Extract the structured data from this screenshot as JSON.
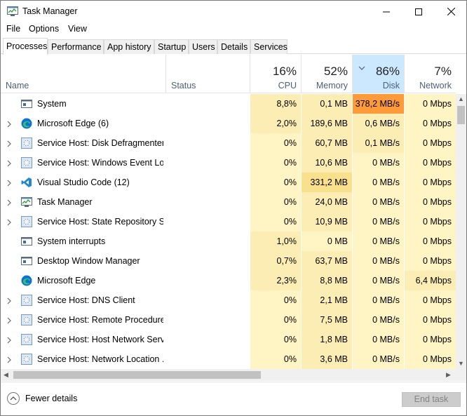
{
  "window": {
    "title": "Task Manager"
  },
  "menu": [
    "File",
    "Options",
    "View"
  ],
  "tabs": [
    "Processes",
    "Performance",
    "App history",
    "Startup",
    "Users",
    "Details",
    "Services"
  ],
  "columns": {
    "name": "Name",
    "status": "Status",
    "cpu": {
      "pct": "16%",
      "label": "CPU"
    },
    "memory": {
      "pct": "52%",
      "label": "Memory"
    },
    "disk": {
      "pct": "86%",
      "label": "Disk"
    },
    "network": {
      "pct": "7%",
      "label": "Network"
    }
  },
  "rows": [
    {
      "name": "System",
      "icon": "system-window-icon",
      "expand": false,
      "cpu": "8,8%",
      "mem": "0,1 MB",
      "disk": "378,2 MB/s",
      "net": "0 Mbps"
    },
    {
      "name": "Microsoft Edge (6)",
      "icon": "edge-icon",
      "expand": true,
      "cpu": "2,0%",
      "mem": "189,6 MB",
      "disk": "0,6 MB/s",
      "net": "0 Mbps"
    },
    {
      "name": "Service Host: Disk Defragmenter",
      "icon": "gear-icon",
      "expand": true,
      "cpu": "0%",
      "mem": "60,7 MB",
      "disk": "0,1 MB/s",
      "net": "0 Mbps"
    },
    {
      "name": "Service Host: Windows Event Log",
      "icon": "gear-icon",
      "expand": true,
      "cpu": "0%",
      "mem": "10,6 MB",
      "disk": "0 MB/s",
      "net": "0 Mbps"
    },
    {
      "name": "Visual Studio Code (12)",
      "icon": "vscode-icon",
      "expand": true,
      "cpu": "0%",
      "mem": "331,2 MB",
      "disk": "0 MB/s",
      "net": "0 Mbps"
    },
    {
      "name": "Task Manager",
      "icon": "task-manager-icon",
      "expand": true,
      "cpu": "0%",
      "mem": "24,0 MB",
      "disk": "0 MB/s",
      "net": "0 Mbps"
    },
    {
      "name": "Service Host: State Repository S...",
      "icon": "gear-icon",
      "expand": true,
      "cpu": "0%",
      "mem": "10,9 MB",
      "disk": "0 MB/s",
      "net": "0 Mbps"
    },
    {
      "name": "System interrupts",
      "icon": "system-window-icon",
      "expand": false,
      "cpu": "1,0%",
      "mem": "0 MB",
      "disk": "0 MB/s",
      "net": "0 Mbps"
    },
    {
      "name": "Desktop Window Manager",
      "icon": "system-window-icon",
      "expand": false,
      "cpu": "0,7%",
      "mem": "63,7 MB",
      "disk": "0 MB/s",
      "net": "0 Mbps"
    },
    {
      "name": "Microsoft Edge",
      "icon": "edge-icon",
      "expand": false,
      "cpu": "2,3%",
      "mem": "8,8 MB",
      "disk": "0 MB/s",
      "net": "6,4 Mbps"
    },
    {
      "name": "Service Host: DNS Client",
      "icon": "gear-icon",
      "expand": true,
      "cpu": "0%",
      "mem": "2,1 MB",
      "disk": "0 MB/s",
      "net": "0 Mbps"
    },
    {
      "name": "Service Host: Remote Procedure...",
      "icon": "gear-icon",
      "expand": true,
      "cpu": "0%",
      "mem": "7,5 MB",
      "disk": "0 MB/s",
      "net": "0 Mbps"
    },
    {
      "name": "Service Host: Host Network Serv...",
      "icon": "gear-icon",
      "expand": true,
      "cpu": "0%",
      "mem": "1,8 MB",
      "disk": "0 MB/s",
      "net": "0 Mbps"
    },
    {
      "name": "Service Host: Network Location ...",
      "icon": "gear-icon",
      "expand": true,
      "cpu": "0%",
      "mem": "3,6 MB",
      "disk": "0 MB/s",
      "net": "0 Mbps"
    }
  ],
  "footer": {
    "fewer_details": "Fewer details",
    "end_task": "End task"
  },
  "colors": {
    "heat_low": "#fff4c4",
    "heat_mid": "#fcedb4",
    "heat_high": "#f9e08d",
    "heat_orange": "#fd9a3a",
    "disk_header": "#cce8ff",
    "edge_blue": "#0c74d4",
    "vscode_blue": "#1f8ad2"
  }
}
